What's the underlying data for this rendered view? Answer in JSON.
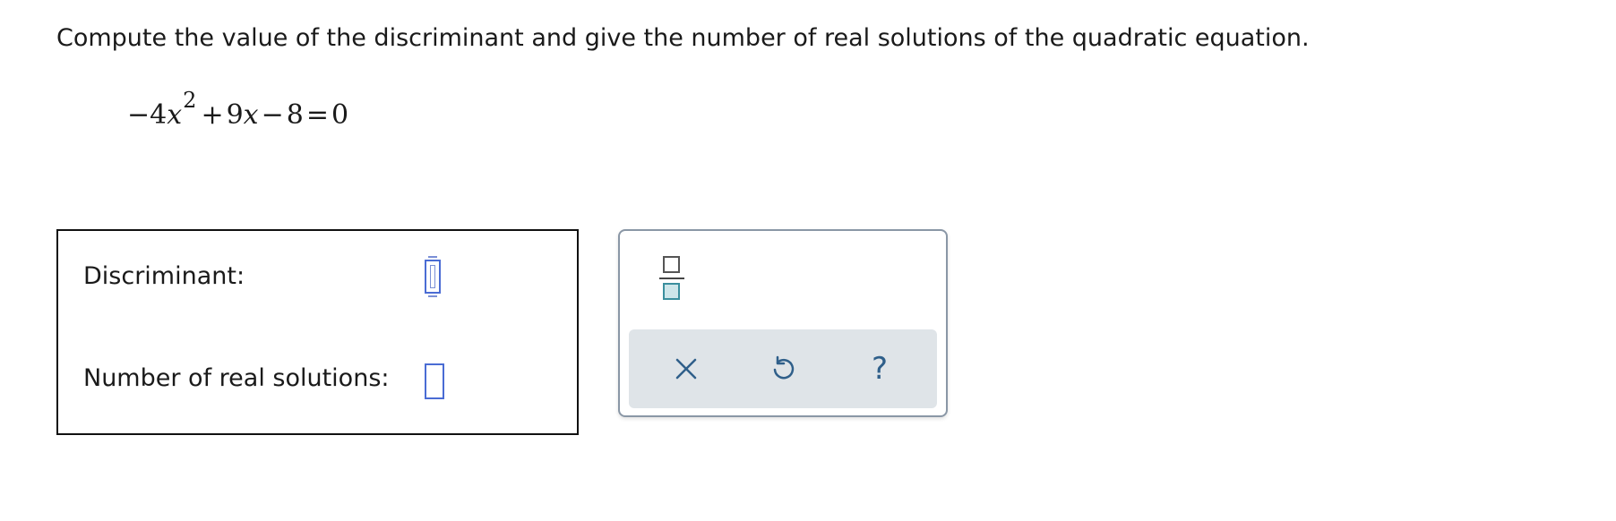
{
  "question": {
    "prompt": "Compute the value of the discriminant and give the number of real solutions of the quadratic equation."
  },
  "equation": {
    "neg_sign": "−",
    "coef_a": "4",
    "var_x1": "x",
    "exponent": "2",
    "plus_sign": "+",
    "coef_b": "9",
    "var_x2": "x",
    "minus_sign": "−",
    "constant": "8",
    "equals": "=",
    "rhs": "0"
  },
  "answer": {
    "discriminant_label": "Discriminant:",
    "discriminant_value": "",
    "solutions_label": "Number of real solutions:",
    "solutions_value": ""
  },
  "toolbox": {
    "fraction_icon": "fraction-icon",
    "clear_icon": "close-icon",
    "undo_icon": "undo-icon",
    "help_label": "?"
  },
  "colors": {
    "input_border": "#4a6cd4",
    "toolbar_bg": "#dfe4e8",
    "icon_accent": "#2f5f8a",
    "fraction_denominator_fill": "#cde6ea"
  }
}
